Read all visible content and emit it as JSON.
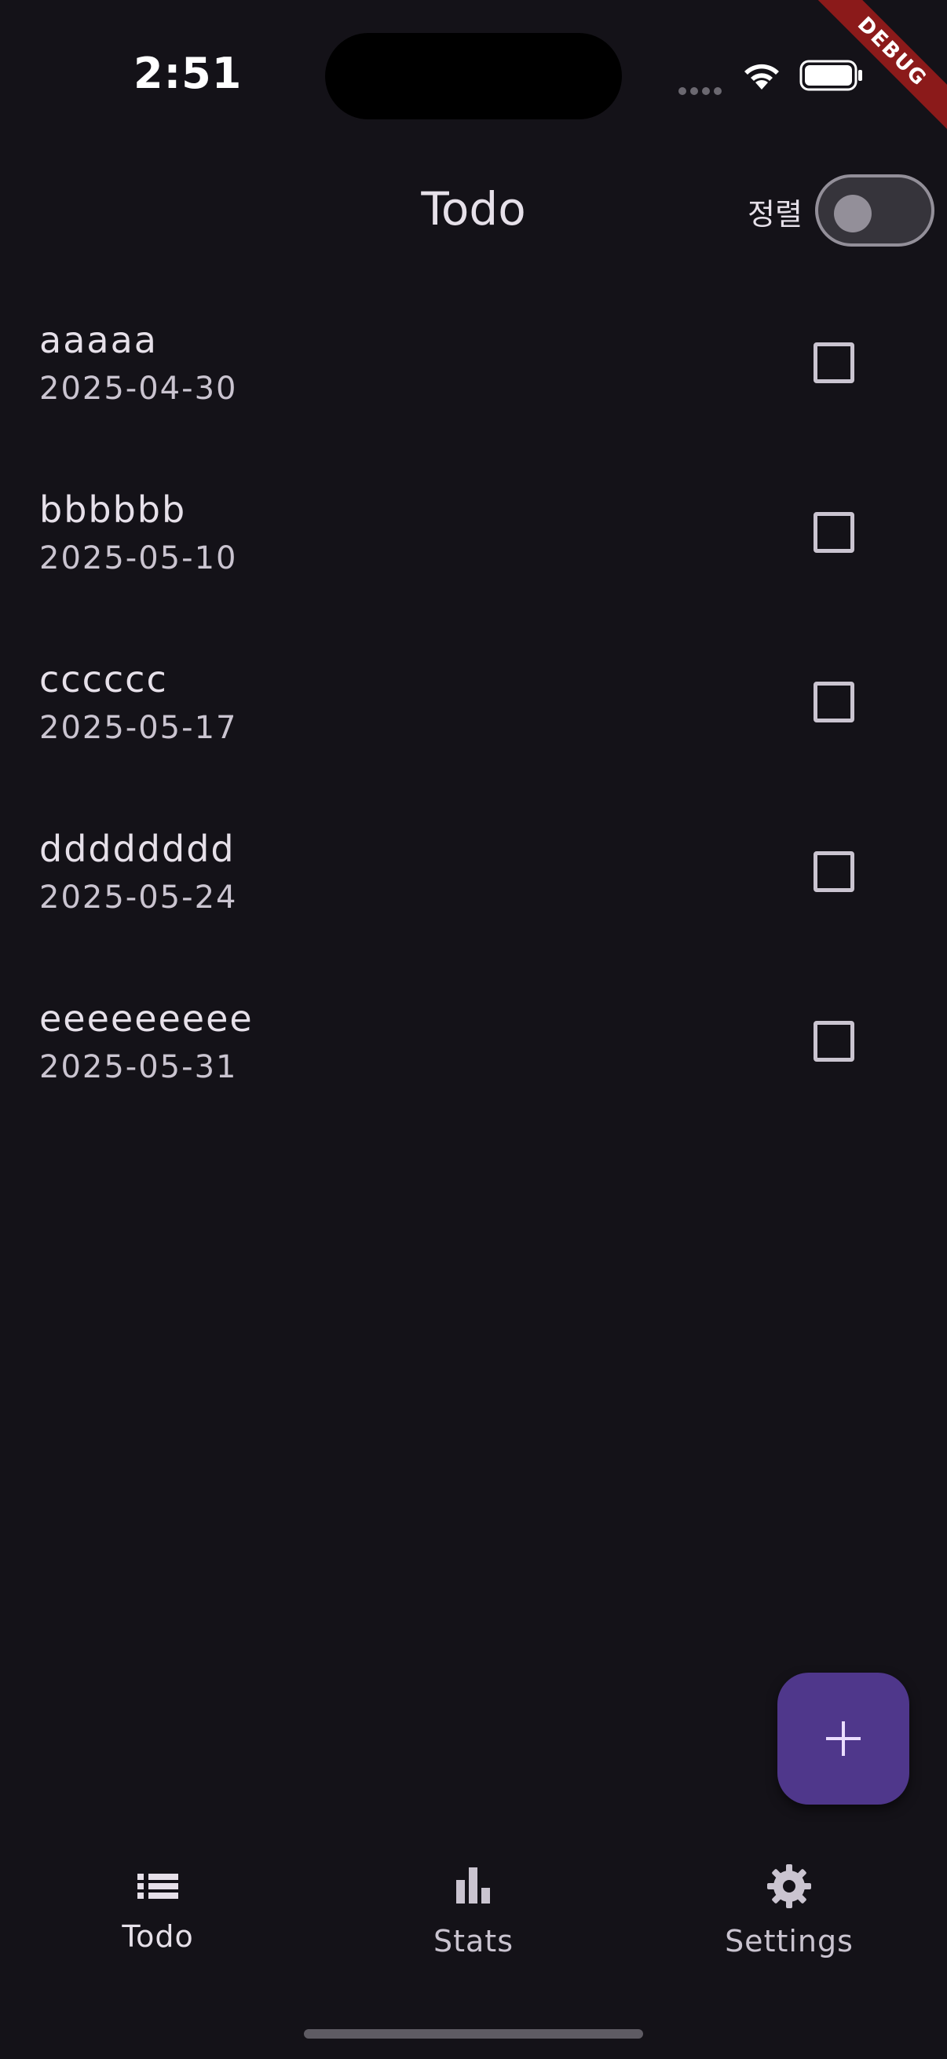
{
  "status_bar": {
    "time": "2:51"
  },
  "debug_banner": "DEBUG",
  "app_bar": {
    "title": "Todo",
    "sort_label": "정렬",
    "sort_toggle_on": false
  },
  "todos": [
    {
      "title": "aaaaa",
      "date": "2025-04-30",
      "checked": false
    },
    {
      "title": "bbbbbb",
      "date": "2025-05-10",
      "checked": false
    },
    {
      "title": "cccccc",
      "date": "2025-05-17",
      "checked": false
    },
    {
      "title": "dddddddd",
      "date": "2025-05-24",
      "checked": false
    },
    {
      "title": "eeeeeeeee",
      "date": "2025-05-31",
      "checked": false
    }
  ],
  "fab": {
    "icon": "plus-icon"
  },
  "bottom_nav": {
    "items": [
      {
        "label": "Todo",
        "icon": "list-icon",
        "active": true
      },
      {
        "label": "Stats",
        "icon": "bar-chart-icon",
        "active": false
      },
      {
        "label": "Settings",
        "icon": "gear-icon",
        "active": false
      }
    ]
  },
  "colors": {
    "background": "#141218",
    "primary_container": "#4F378B",
    "on_surface": "#E6E0E9",
    "on_surface_variant": "#CAC4D0",
    "debug_red": "#8B1A1A"
  }
}
